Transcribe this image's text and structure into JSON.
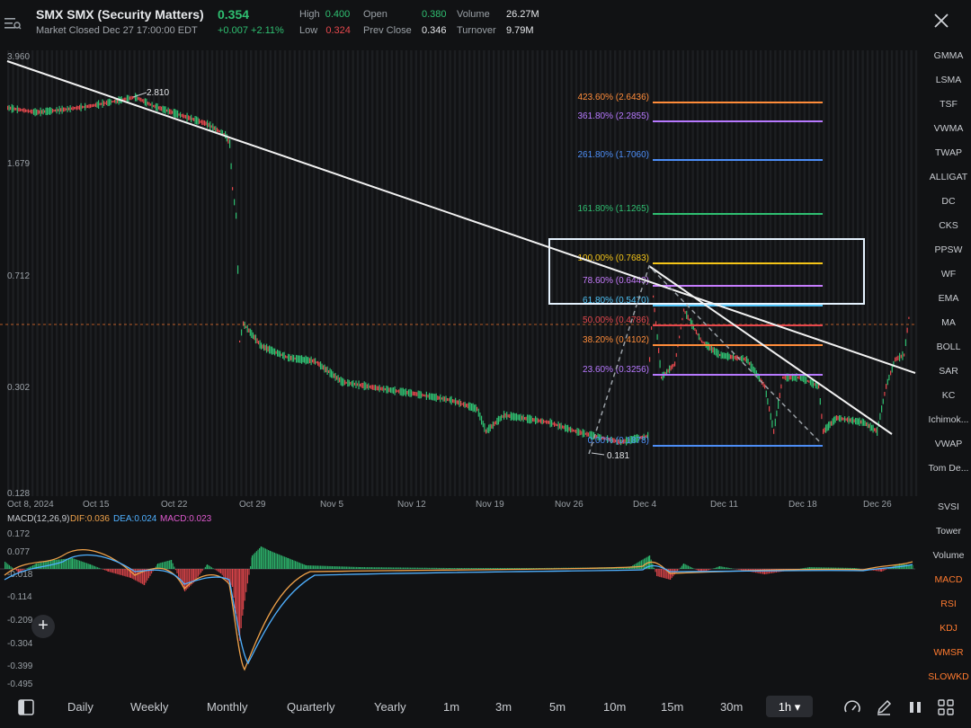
{
  "header": {
    "title": "SMX  SMX (Security Matters)",
    "price": "0.354",
    "status": "Market Closed Dec 27 17:00:00 EDT",
    "change": "+0.007",
    "change_pct": "+2.11%",
    "high_label": "High",
    "high": "0.400",
    "low_label": "Low",
    "low": "0.324",
    "open_label": "Open",
    "open": "0.380",
    "prev_close_label": "Prev Close",
    "prev_close": "0.346",
    "volume_label": "Volume",
    "volume": "26.27M",
    "turnover_label": "Turnover",
    "turnover": "9.79M"
  },
  "main_chart": {
    "y_ticks": [
      "3.960",
      "1.679",
      "0.712",
      "0.302",
      "0.128"
    ],
    "x_ticks": [
      "Oct 8, 2024",
      "Oct 15",
      "Oct 22",
      "Oct 29",
      "Nov 5",
      "Nov 12",
      "Nov 19",
      "Nov 26",
      "Dec 4",
      "Dec 11",
      "Dec 18",
      "Dec 26"
    ],
    "high_marker": "2.810",
    "low_marker": "0.181",
    "fib_levels": [
      {
        "label": "423.60% (2.6436)",
        "color": "#ff8c3a"
      },
      {
        "label": "361.80% (2.2855)",
        "color": "#b779ff"
      },
      {
        "label": "261.80% (1.7060)",
        "color": "#4d8ef7"
      },
      {
        "label": "161.80% (1.1265)",
        "color": "#2fbf71"
      },
      {
        "label": "100.00% (0.7683)",
        "color": "#f5c518"
      },
      {
        "label": "78.60% (0.6443)",
        "color": "#c77dff"
      },
      {
        "label": "61.80% (0.5470)",
        "color": "#4fc3f7"
      },
      {
        "label": "50.00% (0.4786)",
        "color": "#e5484d"
      },
      {
        "label": "38.20% (0.4102)",
        "color": "#ff8c3a"
      },
      {
        "label": "23.60% (0.3256)",
        "color": "#b779ff"
      },
      {
        "label": "0.00% (0.1878)",
        "color": "#4d8ef7"
      }
    ]
  },
  "macd_chart": {
    "legend_name": "MACD(12,26,9)",
    "dif": "DIF:0.036",
    "dea": "DEA:0.024",
    "macd": "MACD:0.023",
    "y_ticks": [
      "0.172",
      "0.077",
      "-0.018",
      "-0.114",
      "-0.209",
      "-0.304",
      "-0.399",
      "-0.495"
    ]
  },
  "right_menu": {
    "overlays": [
      "GMMA",
      "LSMA",
      "TSF",
      "VWMA",
      "TWAP",
      "ALLIGAT",
      "DC",
      "CKS",
      "PPSW",
      "WF",
      "EMA",
      "MA",
      "BOLL",
      "SAR",
      "KC",
      "Ichimok...",
      "VWAP",
      "Tom De..."
    ],
    "indicators": [
      "SVSI",
      "Tower",
      "Volume",
      "MACD",
      "RSI",
      "KDJ",
      "WMSR",
      "SLOWKD"
    ]
  },
  "bottom_bar": {
    "periods": [
      "Daily",
      "Weekly",
      "Monthly",
      "Quarterly",
      "Yearly",
      "1m",
      "3m",
      "5m",
      "10m",
      "15m",
      "30m"
    ],
    "active_period": "1h ▾"
  },
  "colors": {
    "up": "#2fbf71",
    "down": "#e5484d",
    "accent": "#ff7a2f",
    "dif": "#f0a24a",
    "dea": "#4fb0ff"
  }
}
